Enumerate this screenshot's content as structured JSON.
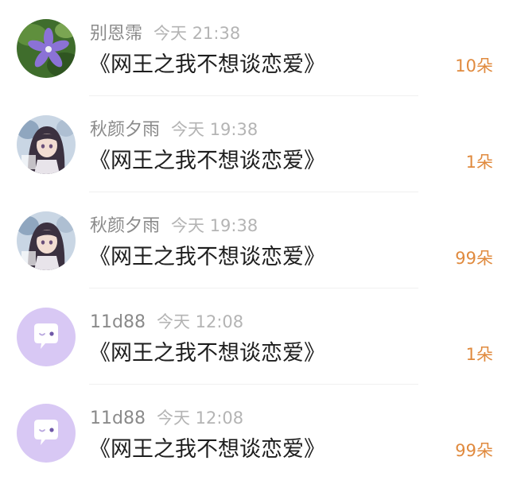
{
  "gifts": [
    {
      "user": "别恩霈",
      "time": "今天 21:38",
      "book": "《网王之我不想谈恋爱》",
      "count": "10朵",
      "avatar": "flower-avatar"
    },
    {
      "user": "秋颜夕雨",
      "time": "今天 19:38",
      "book": "《网王之我不想谈恋爱》",
      "count": "1朵",
      "avatar": "anime-girl-avatar"
    },
    {
      "user": "秋颜夕雨",
      "time": "今天 19:38",
      "book": "《网王之我不想谈恋爱》",
      "count": "99朵",
      "avatar": "anime-girl-avatar"
    },
    {
      "user": "11d88",
      "time": "今天 12:08",
      "book": "《网王之我不想谈恋爱》",
      "count": "1朵",
      "avatar": "default-chat-bubble-avatar"
    },
    {
      "user": "11d88",
      "time": "今天 12:08",
      "book": "《网王之我不想谈恋爱》",
      "count": "99朵",
      "avatar": "default-chat-bubble-avatar"
    }
  ],
  "colors": {
    "count": "#e08a3e",
    "username": "#8a8a8a",
    "time": "#b4b4b4",
    "title": "#1e1e1e",
    "default_avatar_bg": "#d8c8f4"
  }
}
